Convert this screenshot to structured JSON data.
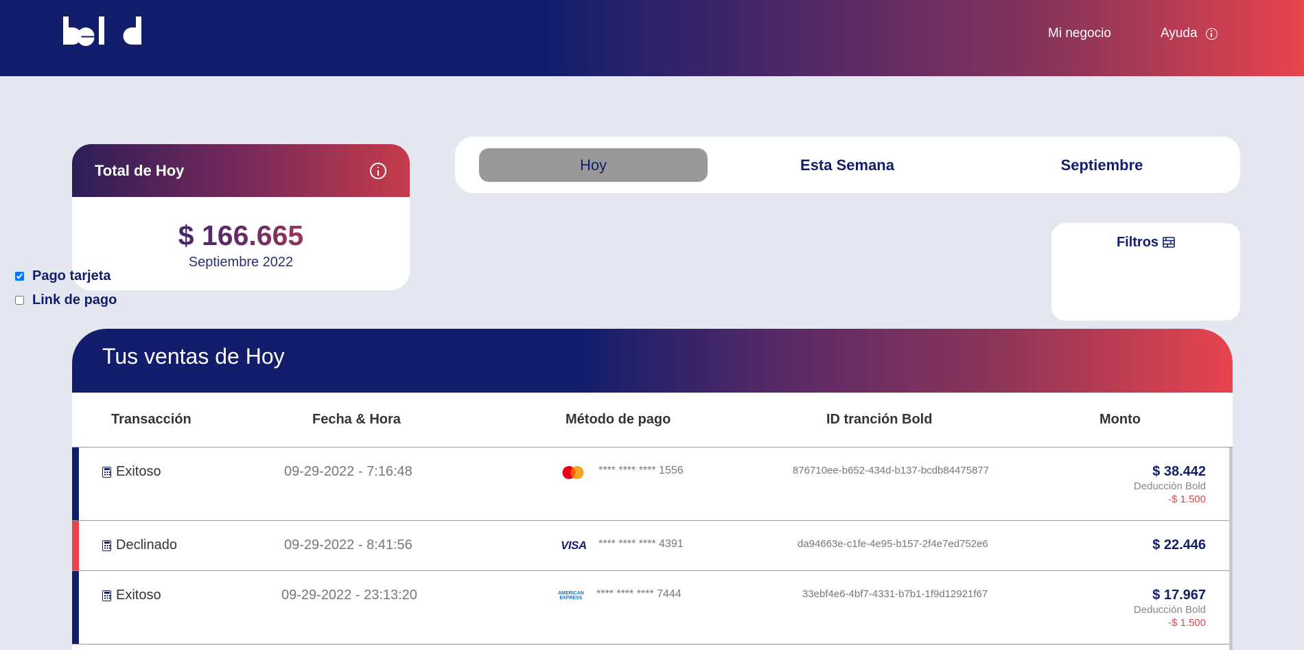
{
  "header": {
    "logo_text": "bold",
    "nav": [
      {
        "label": "Mi negocio"
      },
      {
        "label": "Ayuda"
      }
    ]
  },
  "total_card": {
    "title": "Total de Hoy",
    "amount": "$ 166.665",
    "month": "Septiembre 2022"
  },
  "period_tabs": [
    {
      "label": "Hoy",
      "active": true
    },
    {
      "label": "Esta Semana",
      "active": false
    },
    {
      "label": "Septiembre",
      "active": false
    }
  ],
  "filters": {
    "title": "Filtros",
    "options": [
      {
        "label": "Pago tarjeta",
        "checked": true
      },
      {
        "label": "Link de pago",
        "checked": false
      }
    ]
  },
  "sales": {
    "title": "Tus ventas de Hoy",
    "columns": [
      "Transacción",
      "Fecha & Hora",
      "Método de pago",
      "ID tranción Bold",
      "Monto"
    ],
    "rows": [
      {
        "status": "Exitoso",
        "datetime": "09-29-2022 - 7:16:48",
        "card_brand": "mastercard",
        "card_number": "**** **** **** 1556",
        "tx_id": "876710ee-b652-434d-b137-bcdb84475877",
        "amount": "$ 38.442",
        "deduction_label": "Deducción Bold",
        "deduction_value": "-$ 1.500"
      },
      {
        "status": "Declinado",
        "datetime": "09-29-2022 - 8:41:56",
        "card_brand": "visa",
        "card_brand_text": "VISA",
        "card_number": "**** **** **** 4391",
        "tx_id": "da94663e-c1fe-4e95-b157-2f4e7ed752e6",
        "amount": "$ 22.446"
      },
      {
        "status": "Exitoso",
        "datetime": "09-29-2022 - 23:13:20",
        "card_brand": "amex",
        "card_brand_text": [
          "AMERICAN",
          "EXPRESS"
        ],
        "card_number": "**** **** **** 7444",
        "tx_id": "33ebf4e6-4bf7-4331-b7b1-1f9d12921f67",
        "amount": "$ 17.967",
        "deduction_label": "Deducción Bold",
        "deduction_value": "-$ 1.500"
      }
    ]
  },
  "colors": {
    "navy": "#121e6c",
    "red": "#e8444d",
    "background": "#e4e7ef"
  }
}
